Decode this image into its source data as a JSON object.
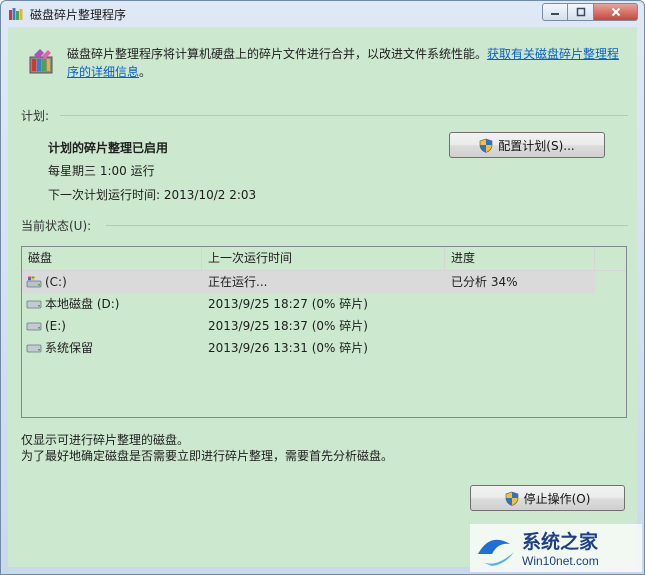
{
  "window": {
    "title": "磁盘碎片整理程序"
  },
  "header": {
    "description": "磁盘碎片整理程序将计算机硬盘上的碎片文件进行合并，以改进文件系统性能。",
    "link_line1": "获取有关磁盘碎片整理程",
    "link_line2": "序的详细信息",
    "period": "。"
  },
  "schedule": {
    "section_label": "计划:",
    "title": "计划的碎片整理已启用",
    "frequency": "每星期三 1:00 运行",
    "next_run": "下一次计划运行时间: 2013/10/2 2:03",
    "configure_button": "配置计划(S)..."
  },
  "status": {
    "section_label": "当前状态(U):",
    "columns": [
      "磁盘",
      "上一次运行时间",
      "进度",
      ""
    ],
    "disks": [
      {
        "name": "(C:)",
        "last_run": "正在运行...",
        "progress": "已分析 34%",
        "icon": "system-drive-icon",
        "selected": true
      },
      {
        "name": "本地磁盘 (D:)",
        "last_run": "2013/9/25 18:27 (0% 碎片)",
        "progress": "",
        "icon": "hard-drive-icon",
        "selected": false
      },
      {
        "name": "(E:)",
        "last_run": "2013/9/25 18:37 (0% 碎片)",
        "progress": "",
        "icon": "hard-drive-icon",
        "selected": false
      },
      {
        "name": "系统保留",
        "last_run": "2013/9/26 13:31 (0% 碎片)",
        "progress": "",
        "icon": "hard-drive-icon",
        "selected": false
      }
    ]
  },
  "footer": {
    "note1": "仅显示可进行碎片整理的磁盘。",
    "note2": "为了最好地确定磁盘是否需要立即进行碎片整理，需要首先分析磁盘。",
    "stop_button": "停止操作(O)"
  },
  "watermark": {
    "brand": "系统之家",
    "site": "Win10net.com"
  },
  "colors": {
    "client_bg": "#cce8cf",
    "link": "#0b5ec9",
    "selected_row": "#dadada"
  }
}
